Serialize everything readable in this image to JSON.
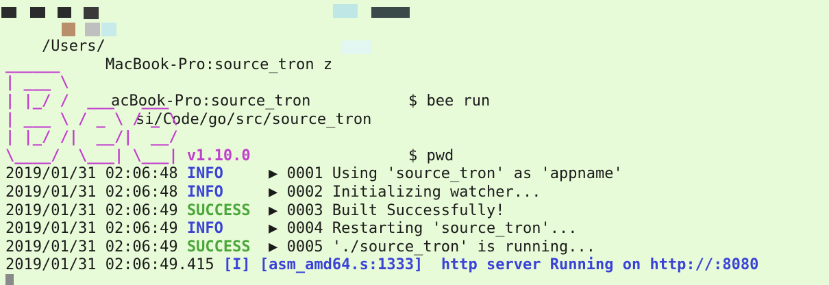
{
  "colors": {
    "background": "#e8fbd8",
    "text": "#1a1a1a",
    "banner": "#c23ecf",
    "info": "#3a43d6",
    "success": "#4aa63a"
  },
  "lines": {
    "l1": "acBook-Pro:source_tron",
    "l1_cmd": "$ pwd",
    "l2_a": "/Users/",
    "l2_b": "si/Code/go/src/source_tron",
    "l3": "MacBook-Pro:source_tron z",
    "l3_cmd": "$ bee run"
  },
  "banner": {
    "rows": [
      "______",
      "| ___ \\",
      "| |_/ /  ___   ___",
      "| ___ \\ / _ \\ / _ \\",
      "| |_/ /|  __/|  __/",
      "\\____/  \\___| \\___|"
    ],
    "version": "v1.10.0"
  },
  "logs": [
    {
      "ts": "2019/01/31 02:06:48",
      "level": "INFO",
      "arrow": "▶",
      "msg": "0001 Using 'source_tron' as 'appname'"
    },
    {
      "ts": "2019/01/31 02:06:48",
      "level": "INFO",
      "arrow": "▶",
      "msg": "0002 Initializing watcher..."
    },
    {
      "ts": "2019/01/31 02:06:49",
      "level": "SUCCESS",
      "arrow": "▶",
      "msg": "0003 Built Successfully!"
    },
    {
      "ts": "2019/01/31 02:06:49",
      "level": "INFO",
      "arrow": "▶",
      "msg": "0004 Restarting 'source_tron'..."
    },
    {
      "ts": "2019/01/31 02:06:49",
      "level": "SUCCESS",
      "arrow": "▶",
      "msg": "0005 './source_tron' is running..."
    }
  ],
  "server_line": {
    "ts": "2019/01/31 02:06:49.415",
    "tag": "[I]",
    "src": "[asm_amd64.s:1333]",
    "msg": "http server Running on http://:8080"
  }
}
